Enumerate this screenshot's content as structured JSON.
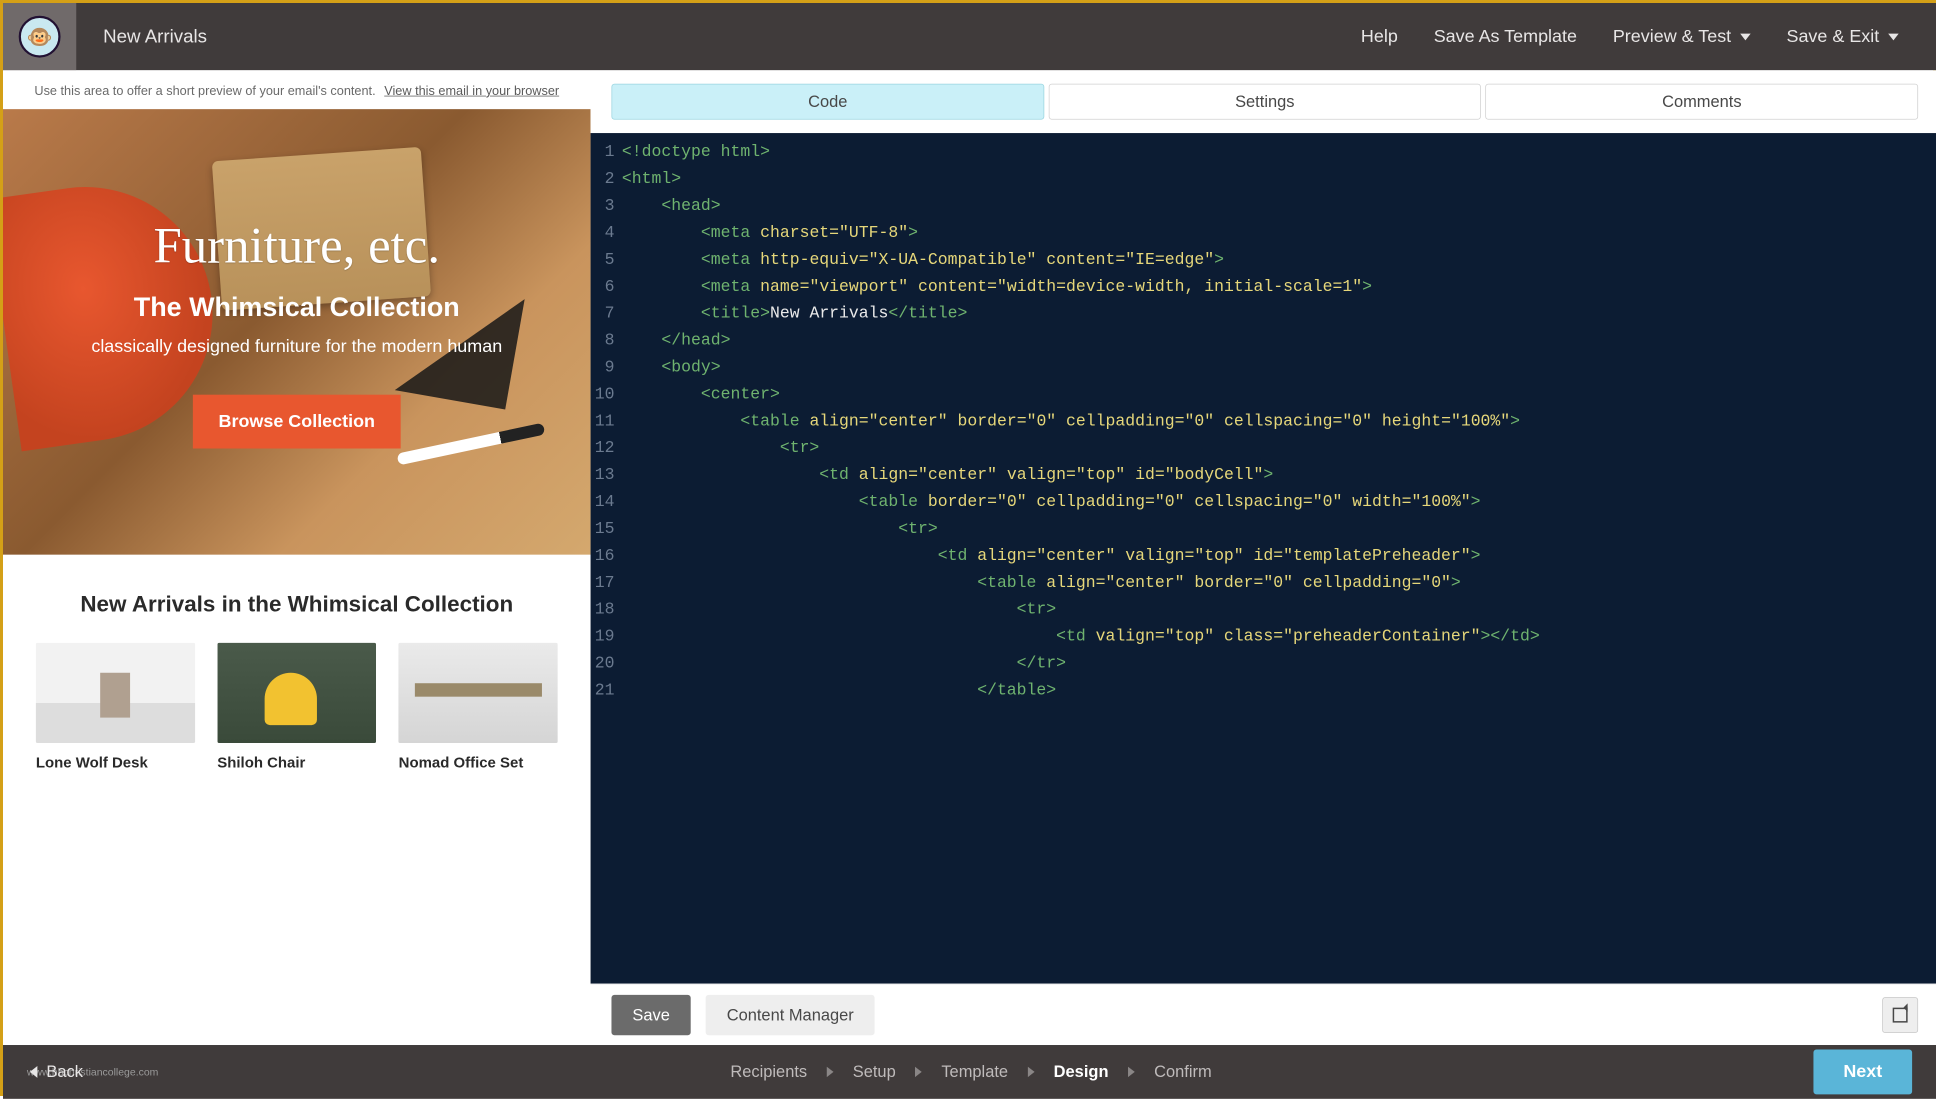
{
  "header": {
    "title": "New Arrivals",
    "links": {
      "help": "Help",
      "save_template": "Save As Template",
      "preview_test": "Preview & Test",
      "save_exit": "Save & Exit"
    }
  },
  "preheader": {
    "hint": "Use this area to offer a short preview of your email's content.",
    "browser_link": "View this email in your browser"
  },
  "hero": {
    "brand": "Furniture, etc.",
    "headline": "The Whimsical Collection",
    "subtext": "classically designed furniture for the modern human",
    "cta": "Browse Collection"
  },
  "arrivals": {
    "title": "New Arrivals in the Whimsical Collection",
    "products": [
      {
        "name": "Lone Wolf Desk"
      },
      {
        "name": "Shiloh Chair"
      },
      {
        "name": "Nomad Office Set"
      }
    ]
  },
  "editor": {
    "tabs": {
      "code": "Code",
      "settings": "Settings",
      "comments": "Comments"
    },
    "code_lines": [
      {
        "n": 1,
        "html": "<span class='t-tag'>&lt;!doctype html&gt;</span>"
      },
      {
        "n": 2,
        "html": "<span class='t-tag'>&lt;html&gt;</span>"
      },
      {
        "n": 3,
        "html": "    <span class='t-tag'>&lt;head&gt;</span>"
      },
      {
        "n": 4,
        "html": "        <span class='t-tag'>&lt;meta</span> <span class='t-attr'>charset=</span><span class='t-str'>\"UTF-8\"</span><span class='t-tag'>&gt;</span>"
      },
      {
        "n": 5,
        "html": "        <span class='t-tag'>&lt;meta</span> <span class='t-attr'>http-equiv=</span><span class='t-str'>\"X-UA-Compatible\"</span> <span class='t-attr'>content=</span><span class='t-str'>\"IE=edge\"</span><span class='t-tag'>&gt;</span>"
      },
      {
        "n": 6,
        "html": "        <span class='t-tag'>&lt;meta</span> <span class='t-attr'>name=</span><span class='t-str'>\"viewport\"</span> <span class='t-attr'>content=</span><span class='t-str'>\"width=device-width, initial-scale=1\"</span><span class='t-tag'>&gt;</span>"
      },
      {
        "n": 7,
        "html": "        <span class='t-tag'>&lt;title&gt;</span><span class='t-txt'>New Arrivals</span><span class='t-tag'>&lt;/title&gt;</span>"
      },
      {
        "n": 8,
        "html": "    <span class='t-tag'>&lt;/head&gt;</span>"
      },
      {
        "n": 9,
        "html": "    <span class='t-tag'>&lt;body&gt;</span>"
      },
      {
        "n": 10,
        "html": "        <span class='t-tag'>&lt;center&gt;</span>"
      },
      {
        "n": 11,
        "html": "            <span class='t-tag'>&lt;table</span> <span class='t-attr'>align=</span><span class='t-str'>\"center\"</span> <span class='t-attr'>border=</span><span class='t-str'>\"0\"</span> <span class='t-attr'>cellpadding=</span><span class='t-str'>\"0\"</span> <span class='t-attr'>cellspacing=</span><span class='t-str'>\"0\"</span> <span class='t-attr'>height=</span><span class='t-str'>\"100%\"</span><span class='t-tag'>&gt;</span>"
      },
      {
        "n": 12,
        "html": "                <span class='t-tag'>&lt;tr&gt;</span>"
      },
      {
        "n": 13,
        "html": "                    <span class='t-tag'>&lt;td</span> <span class='t-attr'>align=</span><span class='t-str'>\"center\"</span> <span class='t-attr'>valign=</span><span class='t-str'>\"top\"</span> <span class='t-attr'>id=</span><span class='t-str'>\"bodyCell\"</span><span class='t-tag'>&gt;</span>"
      },
      {
        "n": 14,
        "html": "                        <span class='t-tag'>&lt;table</span> <span class='t-attr'>border=</span><span class='t-str'>\"0\"</span> <span class='t-attr'>cellpadding=</span><span class='t-str'>\"0\"</span> <span class='t-attr'>cellspacing=</span><span class='t-str'>\"0\"</span> <span class='t-attr'>width=</span><span class='t-str'>\"100%\"</span><span class='t-tag'>&gt;</span>"
      },
      {
        "n": 15,
        "html": "                            <span class='t-tag'>&lt;tr&gt;</span>"
      },
      {
        "n": 16,
        "html": "                                <span class='t-tag'>&lt;td</span> <span class='t-attr'>align=</span><span class='t-str'>\"center\"</span> <span class='t-attr'>valign=</span><span class='t-str'>\"top\"</span> <span class='t-attr'>id=</span><span class='t-str'>\"templatePreheader\"</span><span class='t-tag'>&gt;</span>"
      },
      {
        "n": 17,
        "html": "                                    <span class='t-tag'>&lt;table</span> <span class='t-attr'>align=</span><span class='t-str'>\"center\"</span> <span class='t-attr'>border=</span><span class='t-str'>\"0\"</span> <span class='t-attr'>cellpadding=</span><span class='t-str'>\"0\"</span><span class='t-tag'>&gt;</span>"
      },
      {
        "n": 18,
        "html": "                                        <span class='t-tag'>&lt;tr&gt;</span>"
      },
      {
        "n": 19,
        "html": "                                            <span class='t-tag'>&lt;td</span> <span class='t-attr'>valign=</span><span class='t-str'>\"top\"</span> <span class='t-attr'>class=</span><span class='t-str'>\"preheaderContainer\"</span><span class='t-tag'>&gt;&lt;/td&gt;</span>"
      },
      {
        "n": 20,
        "html": "                                        <span class='t-tag'>&lt;/tr&gt;</span>"
      },
      {
        "n": 21,
        "html": "                                    <span class='t-tag'>&lt;/table&gt;</span>"
      }
    ],
    "buttons": {
      "save": "Save",
      "content_manager": "Content Manager"
    }
  },
  "footer": {
    "back": "Back",
    "watermark": "www.hbchristiancollege.com",
    "steps": [
      "Recipients",
      "Setup",
      "Template",
      "Design",
      "Confirm"
    ],
    "active_step": "Design",
    "next": "Next"
  }
}
